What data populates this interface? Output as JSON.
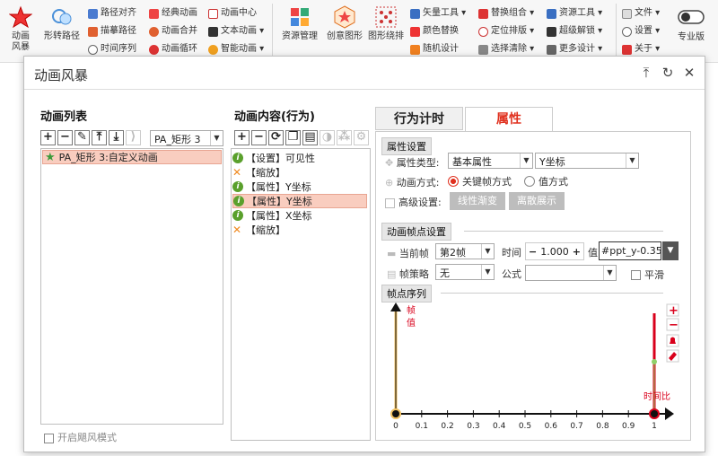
{
  "ribbon": {
    "big": [
      {
        "label": "动画\n风暴",
        "icon": "star-icon"
      },
      {
        "label": "形转路径",
        "icon": "path-shape-icon"
      },
      {
        "label": "资源管理",
        "icon": "palette-icon"
      },
      {
        "label": "创意图形",
        "icon": "star-hexagon-icon"
      },
      {
        "label": "图形绕排",
        "icon": "grid-dots-icon"
      },
      {
        "label": "专业版",
        "icon": "toggle-icon"
      }
    ],
    "col1": [
      "路径对齐",
      "描摹路径",
      "时间序列"
    ],
    "col2": [
      "经典动画",
      "动画合并",
      "动画循环"
    ],
    "col3": [
      "动画中心",
      "文本动画 ▾",
      "智能动画 ▾"
    ],
    "col4": [
      "矢量工具 ▾",
      "颜色替换",
      "随机设计"
    ],
    "col5": [
      "替换组合 ▾",
      "定位排版 ▾",
      "选择清除 ▾"
    ],
    "col6": [
      "资源工具 ▾",
      "超级解锁 ▾",
      "更多设计 ▾"
    ],
    "col7": [
      "文件 ▾",
      "设置 ▾",
      "关于 ▾"
    ]
  },
  "dialog": {
    "title": "动画风暴",
    "controls": {
      "pin": "⤒",
      "refresh": "↻",
      "close": "✕"
    }
  },
  "anim_list": {
    "header": "动画列表",
    "toolbar": [
      "+",
      "−",
      "✎",
      "⤒",
      "⤓"
    ],
    "shape_combo": "PA_矩形 3",
    "items": [
      {
        "label": "PA_矩形 3:自定义动画",
        "selected": true
      }
    ],
    "storm_mode": "开启飓风模式"
  },
  "anim_content": {
    "header": "动画内容(行为)",
    "items": [
      {
        "icon": "info",
        "label": "【设置】可见性",
        "selected": false
      },
      {
        "icon": "scale",
        "label": "【缩放】",
        "selected": false
      },
      {
        "icon": "info",
        "label": "【属性】Y坐标",
        "selected": false
      },
      {
        "icon": "info",
        "label": "【属性】Y坐标",
        "selected": true
      },
      {
        "icon": "info",
        "label": "【属性】X坐标",
        "selected": false
      },
      {
        "icon": "scale",
        "label": "【缩放】",
        "selected": false
      }
    ]
  },
  "tabs": {
    "timing": "行为计时",
    "props": "属性",
    "active": "props"
  },
  "prop_settings": {
    "group": "属性设置",
    "type_label": "属性类型:",
    "type_value": "基本属性",
    "sub_value": "Y坐标",
    "mode_label": "动画方式:",
    "mode_keyframe": "关键帧方式",
    "mode_value": "值方式",
    "mode_selected": "keyframe",
    "advanced_label": "高级设置:",
    "btn_linear": "线性渐变",
    "btn_discrete": "离散展示"
  },
  "keyframe_settings": {
    "group": "动画帧点设置",
    "current_label": "当前帧",
    "current_value": "第2帧",
    "time_label": "时间",
    "time_value": "1.000",
    "value_label": "值",
    "value_input": "#ppt_y-0.35",
    "strategy_label": "帧策略",
    "strategy_value": "无",
    "formula_label": "公式",
    "formula_value": "",
    "smooth_label": "平滑"
  },
  "frame_seq": {
    "group": "帧点序列",
    "y_label": "帧\n值",
    "x_label": "时间比",
    "ticks": [
      "0",
      "0.1",
      "0.2",
      "0.3",
      "0.4",
      "0.5",
      "0.6",
      "0.7",
      "0.8",
      "0.9",
      "1"
    ],
    "side_tools": [
      "+",
      "−",
      "bell-icon",
      "eraser-icon"
    ]
  },
  "colors": {
    "accent": "#d9001b",
    "selected_bg": "#f9cdbf",
    "tab_active": "#e0301e"
  }
}
